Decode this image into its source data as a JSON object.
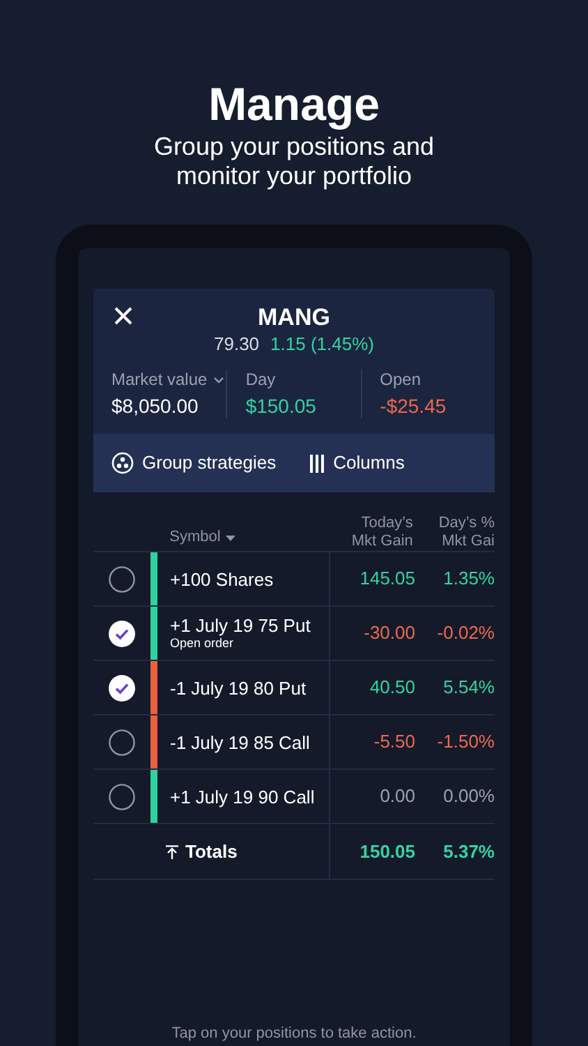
{
  "headline": "Manage",
  "subtitle": "Group your positions and monitor your portfolio",
  "position": {
    "symbol": "MANG",
    "price": "79.30",
    "change": "1.15 (1.45%)",
    "color": "#34d3a2"
  },
  "stats": [
    {
      "label": "Market value",
      "dropdown": true,
      "value": "$8,050.00",
      "color": "#ffffff"
    },
    {
      "label": "Day",
      "dropdown": false,
      "value": "$150.05",
      "color": "#34d3a2"
    },
    {
      "label": "Open",
      "dropdown": false,
      "value": "-$25.45",
      "color": "#ec6a4c"
    }
  ],
  "toolbar": [
    {
      "kind": "group",
      "label": "Group strategies"
    },
    {
      "kind": "columns",
      "label": "Columns"
    }
  ],
  "table": {
    "columns": [
      {
        "label": "Symbol",
        "sortable": true
      },
      {
        "label": "Today’s Mkt Gain",
        "sortable": false
      },
      {
        "label": "Day’s % Mkt Gai",
        "sortable": false
      }
    ],
    "rows": [
      {
        "checked": false,
        "color": "#2ed3a0",
        "symbol": "+100 Shares",
        "gain": {
          "text": "145.05",
          "color": "#34d3a2"
        },
        "pct": {
          "text": "1.35%",
          "color": "#34d3a2"
        }
      },
      {
        "checked": true,
        "color": "#2ed3a0",
        "symbol": "+1 July 19 75 Put",
        "note": "Open order",
        "gain": {
          "text": "-30.00",
          "color": "#ec6a4c"
        },
        "pct": {
          "text": "-0.02%",
          "color": "#ec6a4c"
        }
      },
      {
        "checked": true,
        "color": "#e8613f",
        "symbol": "-1 July 19 80 Put",
        "gain": {
          "text": "40.50",
          "color": "#34d3a2"
        },
        "pct": {
          "text": "5.54%",
          "color": "#34d3a2"
        }
      },
      {
        "checked": false,
        "color": "#e8613f",
        "symbol": "-1 July 19 85 Call",
        "gain": {
          "text": "-5.50",
          "color": "#ec6a4c"
        },
        "pct": {
          "text": "-1.50%",
          "color": "#ec6a4c"
        }
      },
      {
        "checked": false,
        "color": "#2ed3a0",
        "symbol": "+1 July 19 90 Call",
        "gain": {
          "text": "0.00",
          "color": "#9aa1b3"
        },
        "pct": {
          "text": "0.00%",
          "color": "#9aa1b3"
        }
      }
    ],
    "totals": {
      "label": "Totals",
      "gain": {
        "text": "150.05",
        "color": "#34d3a2"
      },
      "pct": {
        "text": "5.37%",
        "color": "#34d3a2"
      }
    }
  },
  "footer": "Tap on your positions to take action."
}
